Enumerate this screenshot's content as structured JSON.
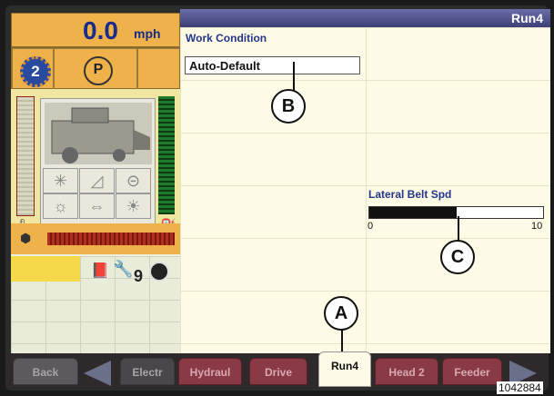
{
  "speed": {
    "value": "0.0",
    "unit": "mph"
  },
  "status": {
    "gear": "2",
    "park": "P",
    "count": "9"
  },
  "header": {
    "title": "Run4"
  },
  "work_condition": {
    "label": "Work Condition",
    "value": "Auto-Default"
  },
  "lateral_belt": {
    "label": "Lateral Belt Spd",
    "min": "0",
    "max": "10",
    "level_fraction": 0.5
  },
  "callouts": {
    "a": "A",
    "b": "B",
    "c": "C"
  },
  "nav": {
    "back": "Back",
    "tab1": "Electr",
    "tab2": "Hydraul",
    "tab3": "Drive",
    "tab4": "Run4",
    "tab5": "Head 2",
    "tab6": "Feeder"
  },
  "figure_id": "1042884",
  "colors": {
    "accent": "#efb24a",
    "header": "#3c3f78",
    "tab": "#8a3a45",
    "label": "#24358a"
  }
}
